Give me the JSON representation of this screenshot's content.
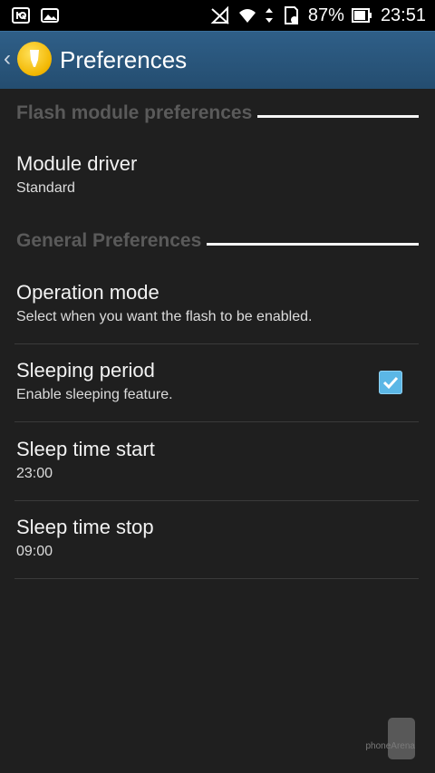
{
  "status_bar": {
    "battery": "87%",
    "time": "23:51"
  },
  "action_bar": {
    "title": "Preferences"
  },
  "sections": [
    {
      "title": "Flash module preferences"
    },
    {
      "title": "General Preferences"
    }
  ],
  "items": [
    {
      "title": "Module driver",
      "summary": "Standard"
    },
    {
      "title": "Operation mode",
      "summary": "Select when you want the flash to be enabled."
    },
    {
      "title": "Sleeping period",
      "summary": "Enable sleeping feature.",
      "checked": true
    },
    {
      "title": "Sleep time start",
      "summary": "23:00"
    },
    {
      "title": "Sleep time stop",
      "summary": "09:00"
    }
  ],
  "watermark": {
    "brand": "phoneArena"
  },
  "colors": {
    "actionbar": "#2a5678",
    "checkbox": "#5bb7e6",
    "background": "#1f1f1f"
  }
}
